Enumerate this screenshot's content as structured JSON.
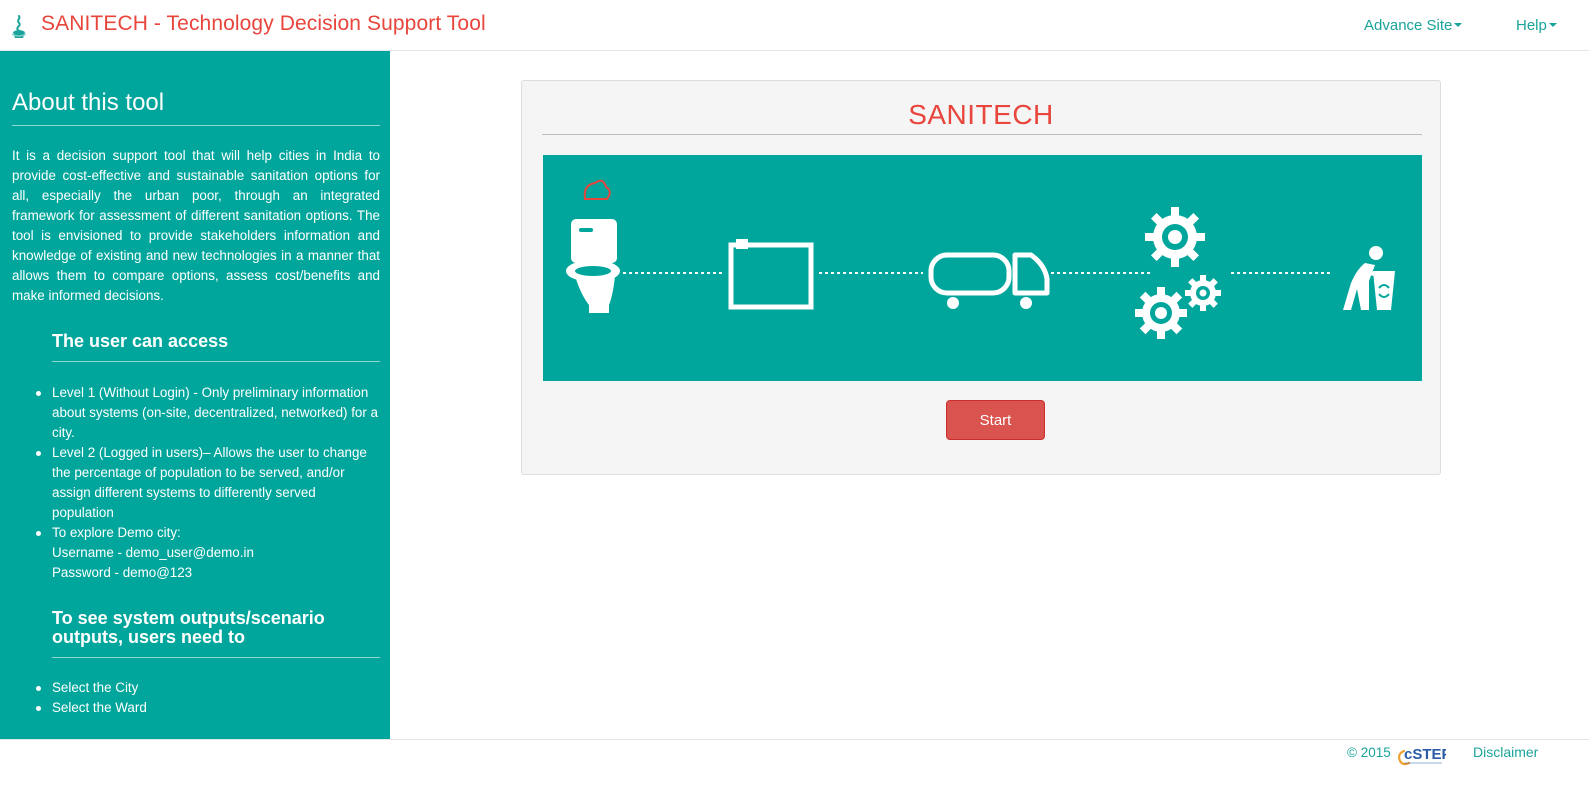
{
  "header": {
    "title": "SANITECH - Technology Decision Support Tool",
    "nav": [
      {
        "label": "Advance Site"
      },
      {
        "label": "Help"
      }
    ]
  },
  "sidebar": {
    "title": "About this tool",
    "intro": "It is a decision support tool that will help cities in India to provide cost-effective and sustainable sanitation options for all, especially the urban poor, through an integrated framework for assessment of different sanitation options. The tool is envisioned to provide stakeholders information and knowledge of existing and new technologies in a manner that allows them to compare options, assess cost/benefits and make informed decisions.",
    "access_title": "The user can access",
    "access_items": [
      {
        "text": "Level 1 (Without Login) - Only preliminary information about systems (on-site, decentralized, networked) for a city."
      },
      {
        "text": "Level 2 (Logged in users)– Allows the user to change the percentage of population to be served, and/or assign different systems to differently served population"
      },
      {
        "lines": [
          "To explore Demo city:",
          "Username - demo_user@demo.in",
          "Password - demo@123"
        ]
      }
    ],
    "outputs_title": "To see system outputs/scenario outputs, users need to",
    "outputs_items": [
      "Select the City",
      "Select the Ward"
    ]
  },
  "main": {
    "title": "SANITECH",
    "start_label": "Start"
  },
  "footer": {
    "copyright": "© 2015",
    "logo_text": "cSTEP",
    "disclaimer": "Disclaimer"
  },
  "colors": {
    "brand_red": "#e8453c",
    "teal": "#00a69c",
    "button_red": "#d9534f",
    "link_teal": "#1aa39a"
  },
  "icons": [
    "logo-icon",
    "caret-down-icon",
    "toilet-icon",
    "containment-tank-icon",
    "transport-truck-icon",
    "treatment-gears-icon",
    "reuse-disposal-icon",
    "cstep-logo"
  ]
}
